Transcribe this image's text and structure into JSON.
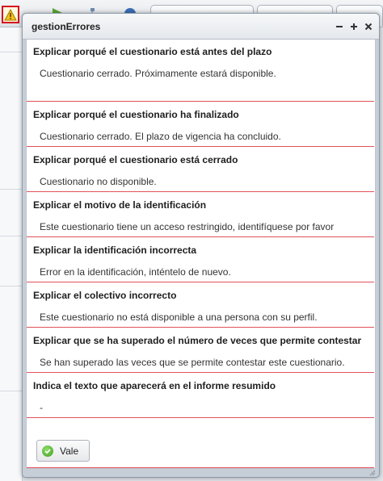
{
  "dialog": {
    "title": "gestionErrores",
    "window_buttons": [
      "−",
      "+",
      "×"
    ],
    "sections": [
      {
        "title": "Explicar porqué el cuestionario está antes del plazo",
        "text": "Cuestionario cerrado. Próximamente estará disponible."
      },
      {
        "title": "Explicar porqué el cuestionario ha finalizado",
        "text": "Cuestionario cerrado. El plazo de vigencia ha concluido."
      },
      {
        "title": "Explicar porqué el cuestionario está cerrado",
        "text": "Cuestionario no disponible."
      },
      {
        "title": "Explicar el motivo de la identificación",
        "text": "Este cuestionario tiene un acceso restringido, identifíquese por favor"
      },
      {
        "title": "Explicar la identificación incorrecta",
        "text": "Error en la identificación, inténtelo de nuevo."
      },
      {
        "title": "Explicar el colectivo incorrecto",
        "text": "Este cuestionario no está disponible a una persona con su perfil."
      },
      {
        "title": "Explicar que se ha superado el número de veces que permite contestar",
        "text": "Se han superado las veces que se permite contestar este cuestionario."
      },
      {
        "title": "Indica el texto que aparecerá en el informe resumido",
        "text": "-"
      }
    ],
    "ok_button_label": "Vale"
  },
  "icons": {
    "warning": "warning-icon",
    "ok": "check-circle-icon"
  },
  "colors": {
    "separator": "#e0525a",
    "highlight_border": "#d6141e",
    "ok_green": "#3f9d22"
  }
}
